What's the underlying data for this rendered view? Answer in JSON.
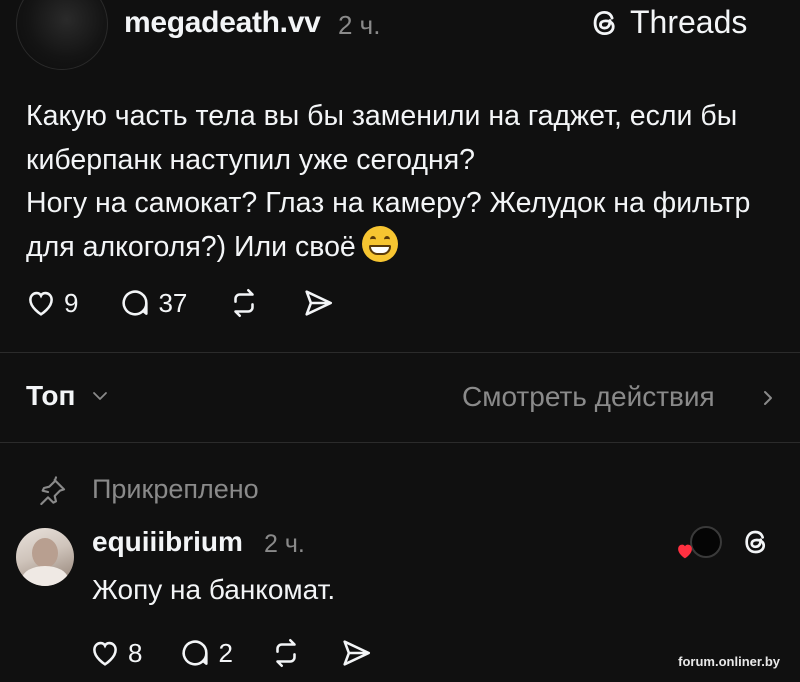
{
  "post": {
    "username": "megadeath.vv",
    "time": "2 ч.",
    "brand": "Threads",
    "text_paragraph_1": "Какую часть тела вы бы заменили на гаджет, если бы киберпанк наступил уже сегодня?",
    "text_paragraph_2": "Ногу на самокат? Глаз на камеру? Желудок на фильтр для алкоголя?) Или своё",
    "emoji": "grinning-face-emoji",
    "likes": "9",
    "comments": "37"
  },
  "sort": {
    "label": "Топ",
    "view_activity": "Смотреть действия"
  },
  "pinned": {
    "label": "Прикреплено"
  },
  "reply": {
    "username": "equiiibrium",
    "time": "2 ч.",
    "text": "Жопу на банкомат.",
    "likes": "8",
    "comments": "2"
  },
  "watermark": "forum.onliner.by",
  "colors": {
    "background": "#101010",
    "text": "#f3f5f7",
    "muted": "#8a8a8a",
    "heart_red": "#ff3040"
  }
}
